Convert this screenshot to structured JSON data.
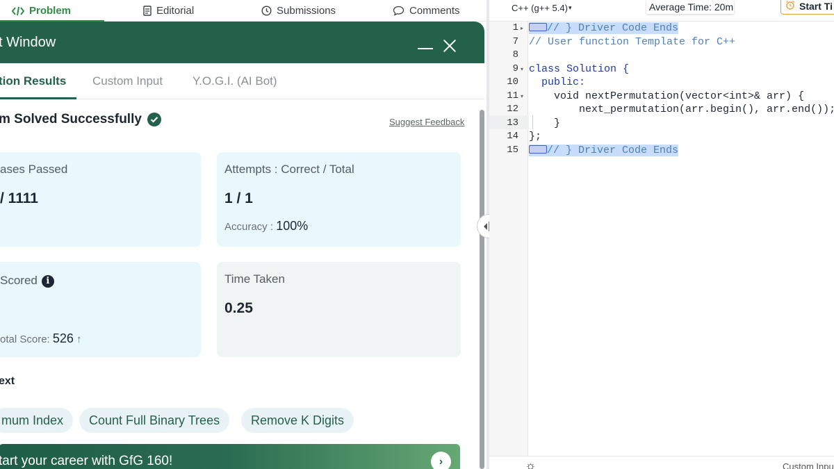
{
  "nav": {
    "tabs": [
      {
        "label": "Problem",
        "icon": "code-icon"
      },
      {
        "label": "Editorial",
        "icon": "document-icon"
      },
      {
        "label": "Submissions",
        "icon": "clock-icon"
      },
      {
        "label": "Comments",
        "icon": "comment-icon"
      }
    ]
  },
  "result_window": {
    "title": "t Window",
    "subtabs": [
      "tion Results",
      "Custom Input",
      "Y.O.G.I. (AI Bot)"
    ],
    "solved_text": "m Solved Successfully",
    "feedback_link": "Suggest Feedback",
    "cards": {
      "test_cases": {
        "label": "ases Passed",
        "value": "/ 1111"
      },
      "attempts": {
        "label": "Attempts : Correct / Total",
        "value": "1 / 1",
        "sub_label": "Accuracy :",
        "sub_value": "100%"
      },
      "score": {
        "label": "Scored",
        "sub_label": "otal Score:",
        "sub_value": "526"
      },
      "time": {
        "label": "Time Taken",
        "value": "0.25"
      }
    },
    "next_heading": "ext",
    "next_problems": [
      "mum Index",
      "Count Full Binary Trees",
      "Remove K Digits"
    ],
    "banner_text": "tart your career with GfG 160!"
  },
  "editor": {
    "language": "C++ (g++ 5.4)",
    "average_time": "Average Time: 20m",
    "start_timer": "Start Ti",
    "line_numbers": [
      "1",
      "7",
      "8",
      "9",
      "10",
      "11",
      "12",
      "13",
      "14",
      "15"
    ],
    "lines": [
      "// } Driver Code Ends",
      "// User function Template for C++",
      "",
      "class Solution {",
      "  public:",
      "    void nextPermutation(vector<int>& arr) {",
      "        next_permutation(arr.begin(), arr.end());",
      "    }",
      "};",
      "// } Driver Code Ends"
    ],
    "bottom_label": "Custom Inpu"
  }
}
